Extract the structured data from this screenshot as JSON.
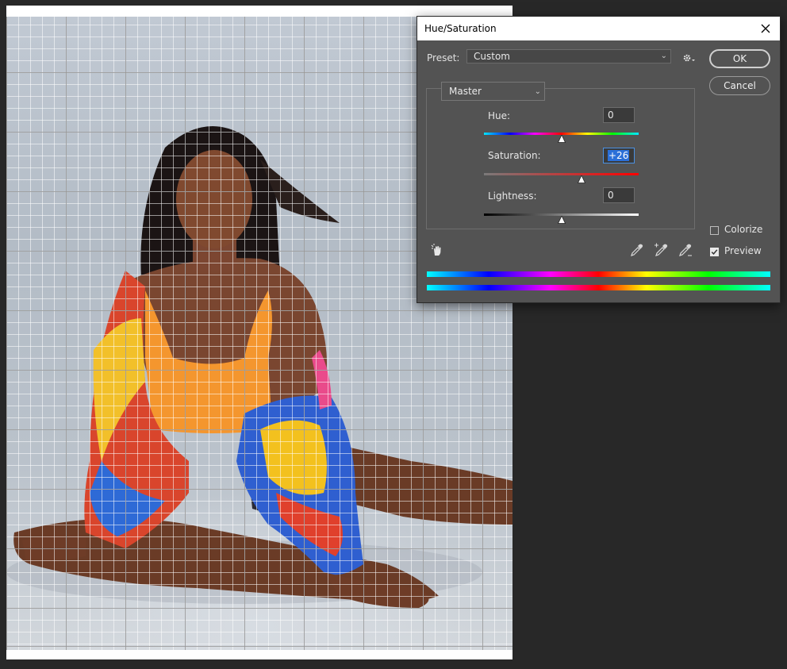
{
  "dialog": {
    "title": "Hue/Saturation",
    "preset_label": "Preset:",
    "preset_value": "Custom",
    "channel_value": "Master",
    "ok_label": "OK",
    "cancel_label": "Cancel",
    "hue_label": "Hue:",
    "hue_value": "0",
    "hue_level": 0,
    "saturation_label": "Saturation:",
    "saturation_value": "+26",
    "saturation_level": 26,
    "lightness_label": "Lightness:",
    "lightness_value": "0",
    "lightness_level": 0,
    "colorize_label": "Colorize",
    "colorize_checked": false,
    "preview_label": "Preview",
    "preview_checked": true
  },
  "icons": {
    "close": "close-icon",
    "gear": "gear-icon",
    "hand": "on-image-adjust-icon",
    "eyedropper": "eyedropper-icon",
    "eyedropper_plus": "eyedropper-plus-icon",
    "eyedropper_minus": "eyedropper-minus-icon"
  },
  "colors": {
    "app_background": "#282828",
    "dialog_background": "#535353",
    "field_focus": "#4a90e2",
    "selection": "#2b6fd8"
  }
}
